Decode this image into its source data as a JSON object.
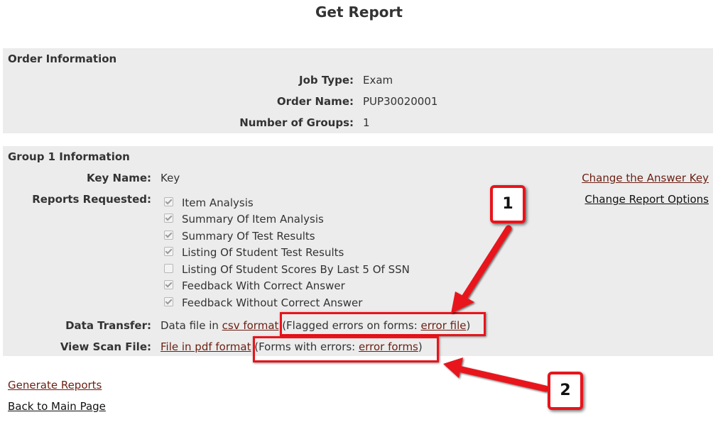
{
  "page": {
    "title": "Get Report"
  },
  "order": {
    "heading": "Order Information",
    "job_type_label": "Job Type:",
    "job_type": "Exam",
    "order_name_label": "Order Name:",
    "order_name": "PUP30020001",
    "groups_label": "Number of Groups:",
    "groups": "1"
  },
  "group": {
    "heading": "Group 1 Information",
    "key_name_label": "Key Name:",
    "key_name": "Key",
    "change_key": "Change the Answer Key",
    "reports_label": "Reports Requested:",
    "change_options": "Change Report Options",
    "reports": [
      {
        "label": "Item Analysis",
        "checked": true
      },
      {
        "label": "Summary Of Item Analysis",
        "checked": true
      },
      {
        "label": "Summary Of Test Results",
        "checked": true
      },
      {
        "label": "Listing Of Student Test Results",
        "checked": true
      },
      {
        "label": "Listing Of Student Scores By Last 5 Of SSN",
        "checked": false
      },
      {
        "label": "Feedback With Correct Answer",
        "checked": true
      },
      {
        "label": "Feedback Without Correct Answer",
        "checked": true
      }
    ],
    "data_transfer_label": "Data Transfer:",
    "data_transfer_prefix": "Data file in ",
    "csv_link": "csv format",
    "flagged_prefix": "(Flagged errors on forms: ",
    "error_file_link": "error file",
    "close_paren": ")",
    "scan_label": "View Scan File:",
    "pdf_link": "File in pdf format",
    "forms_prefix": "(Forms with errors: ",
    "error_forms_link": "error forms",
    "close_paren2": ")"
  },
  "footer": {
    "generate": "Generate Reports",
    "back": "Back to Main Page"
  },
  "annotations": {
    "badge1": "1",
    "badge2": "2",
    "color": "#e8141b"
  },
  "colors": {
    "panel": "#ececec",
    "link": "#6b1f12"
  }
}
